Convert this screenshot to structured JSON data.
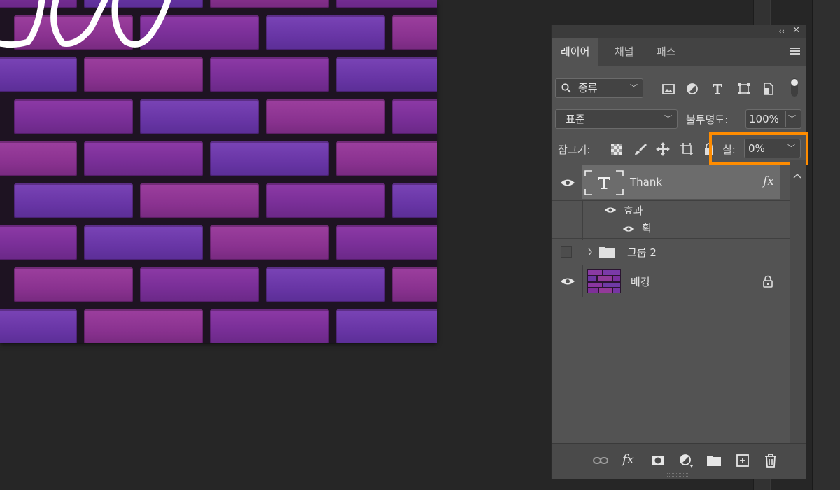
{
  "panel": {
    "collapse_glyph": "‹‹",
    "close_glyph": "✕",
    "tabs": [
      {
        "label": "레이어",
        "active": true
      },
      {
        "label": "채널",
        "active": false
      },
      {
        "label": "패스",
        "active": false
      }
    ],
    "filter": {
      "kind_label": "종류",
      "icons": [
        "image-filter-icon",
        "adjustment-filter-icon",
        "type-filter-icon",
        "shape-filter-icon",
        "smart-object-filter-icon",
        "filter-toggle-icon"
      ]
    },
    "blend_mode": "표준",
    "opacity_label": "불투명도:",
    "opacity_value": "100%",
    "lock_label": "잠그기:",
    "lock_icons": [
      "lock-transparent-icon",
      "lock-image-icon",
      "lock-position-icon",
      "lock-artboard-icon",
      "lock-all-icon"
    ],
    "fill_label": "칠:",
    "fill_value": "0%",
    "highlight_color": "#ff8c00"
  },
  "layers": [
    {
      "name": "Thank",
      "type": "text",
      "visible": true,
      "selected": true,
      "fx": "fx"
    },
    {
      "name": "효과",
      "type": "effects-header",
      "visible": true
    },
    {
      "name": "획",
      "type": "effect",
      "visible": true
    },
    {
      "name": "그룹 2",
      "type": "group",
      "visible": false
    },
    {
      "name": "배경",
      "type": "background",
      "visible": true,
      "locked": true
    }
  ],
  "bottom_icons": [
    "link-layers-icon",
    "fx-icon",
    "mask-icon",
    "adjustment-layer-icon",
    "new-group-icon",
    "new-layer-icon",
    "delete-icon"
  ]
}
